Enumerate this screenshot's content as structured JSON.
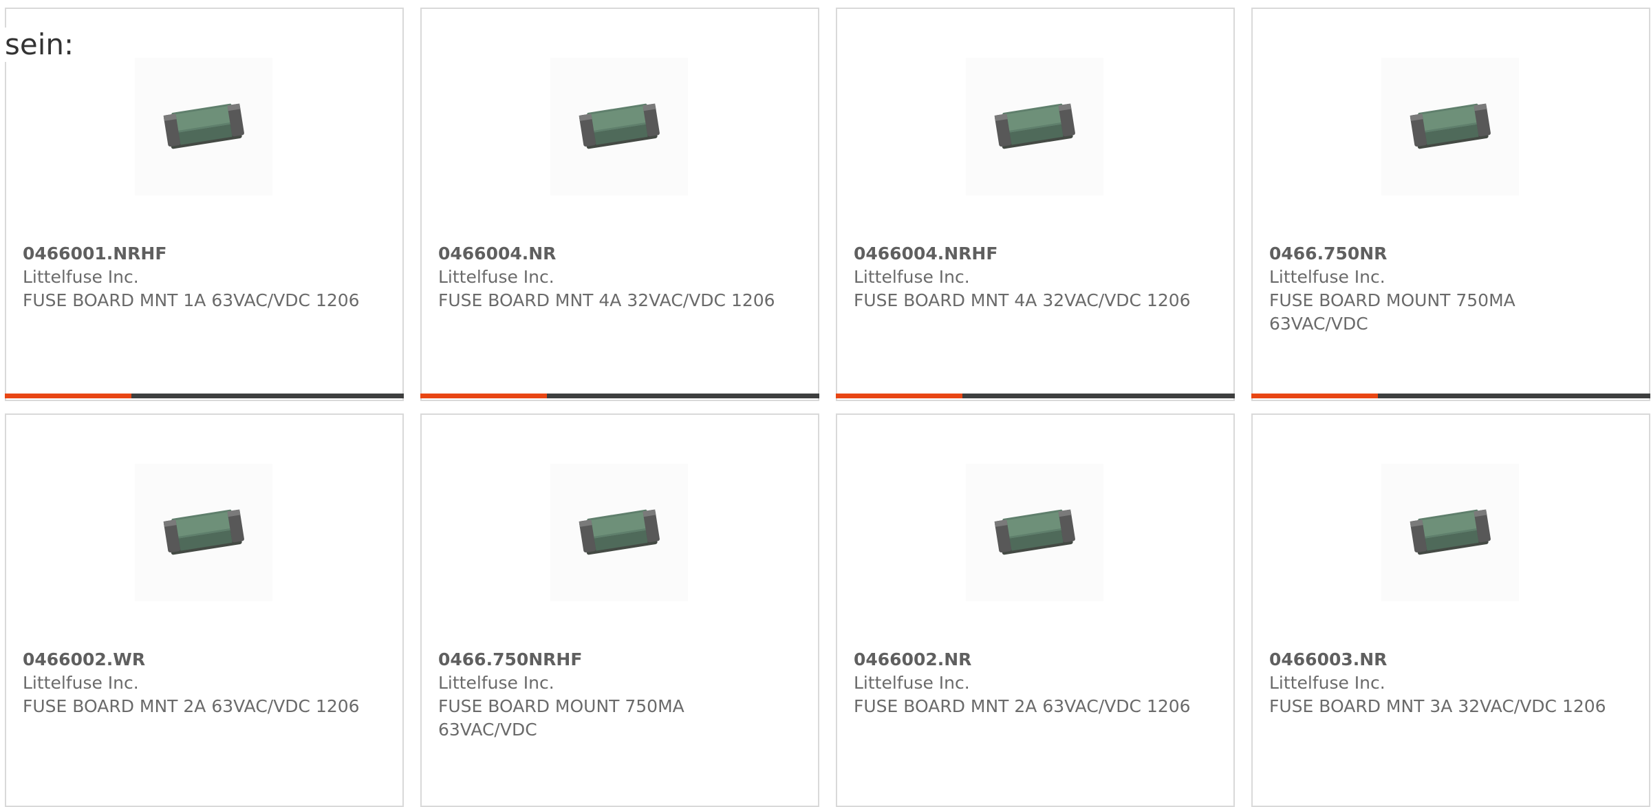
{
  "intro_text": "sein:",
  "colors": {
    "accent": "#e84614",
    "bar": "#3e3f3f",
    "border": "#d9d9d9",
    "text": "#6a6a6a"
  },
  "products": [
    {
      "part_number": "0466001.NRHF",
      "manufacturer": "Littelfuse Inc.",
      "description": "FUSE BOARD MNT 1A 63VAC/VDC 1206",
      "image": "smd-fuse-icon"
    },
    {
      "part_number": "0466004.NR",
      "manufacturer": "Littelfuse Inc.",
      "description": "FUSE BOARD MNT 4A 32VAC/VDC 1206",
      "image": "smd-fuse-icon"
    },
    {
      "part_number": "0466004.NRHF",
      "manufacturer": "Littelfuse Inc.",
      "description": "FUSE BOARD MNT 4A 32VAC/VDC 1206",
      "image": "smd-fuse-icon"
    },
    {
      "part_number": "0466.750NR",
      "manufacturer": "Littelfuse Inc.",
      "description": "FUSE BOARD MOUNT 750MA 63VAC/VDC",
      "image": "smd-fuse-icon"
    },
    {
      "part_number": "0466002.WR",
      "manufacturer": "Littelfuse Inc.",
      "description": "FUSE BOARD MNT 2A 63VAC/VDC 1206",
      "image": "smd-fuse-icon"
    },
    {
      "part_number": "0466.750NRHF",
      "manufacturer": "Littelfuse Inc.",
      "description": "FUSE BOARD MOUNT 750MA 63VAC/VDC",
      "image": "smd-fuse-icon"
    },
    {
      "part_number": "0466002.NR",
      "manufacturer": "Littelfuse Inc.",
      "description": "FUSE BOARD MNT 2A 63VAC/VDC 1206",
      "image": "smd-fuse-icon"
    },
    {
      "part_number": "0466003.NR",
      "manufacturer": "Littelfuse Inc.",
      "description": "FUSE BOARD MNT 3A 32VAC/VDC 1206",
      "image": "smd-fuse-icon"
    }
  ]
}
